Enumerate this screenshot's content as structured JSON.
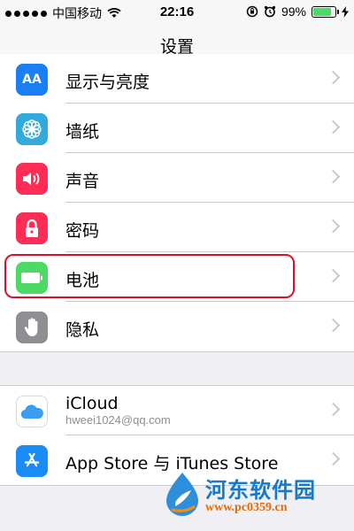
{
  "status_bar": {
    "carrier": "中国移动",
    "time": "22:16",
    "battery_percent": "99%",
    "battery_level": 0.99
  },
  "nav": {
    "title": "设置"
  },
  "group1": {
    "items": [
      {
        "label": "显示与亮度",
        "icon": "display-brightness-icon",
        "color": "#1a7ef5"
      },
      {
        "label": "墙纸",
        "icon": "wallpaper-flower-icon",
        "color": "#34aadc"
      },
      {
        "label": "声音",
        "icon": "speaker-icon",
        "color": "#ff2d55"
      },
      {
        "label": "密码",
        "icon": "lock-icon",
        "color": "#ff2d55"
      },
      {
        "label": "电池",
        "icon": "battery-icon",
        "color": "#4cd964"
      },
      {
        "label": "隐私",
        "icon": "hand-icon",
        "color": "#8e8e93"
      }
    ]
  },
  "group2": {
    "items": [
      {
        "label": "iCloud",
        "sublabel": "hweei1024@qq.com",
        "icon": "icloud-icon",
        "color": "#ffffff"
      },
      {
        "label": "App Store 与 iTunes Store",
        "icon": "app-store-icon",
        "color": "#1a8cf5"
      }
    ]
  },
  "watermark": {
    "name": "河东软件园",
    "url": "www.pc0359.cn"
  },
  "icon_glyphs": {
    "display": "AA"
  }
}
